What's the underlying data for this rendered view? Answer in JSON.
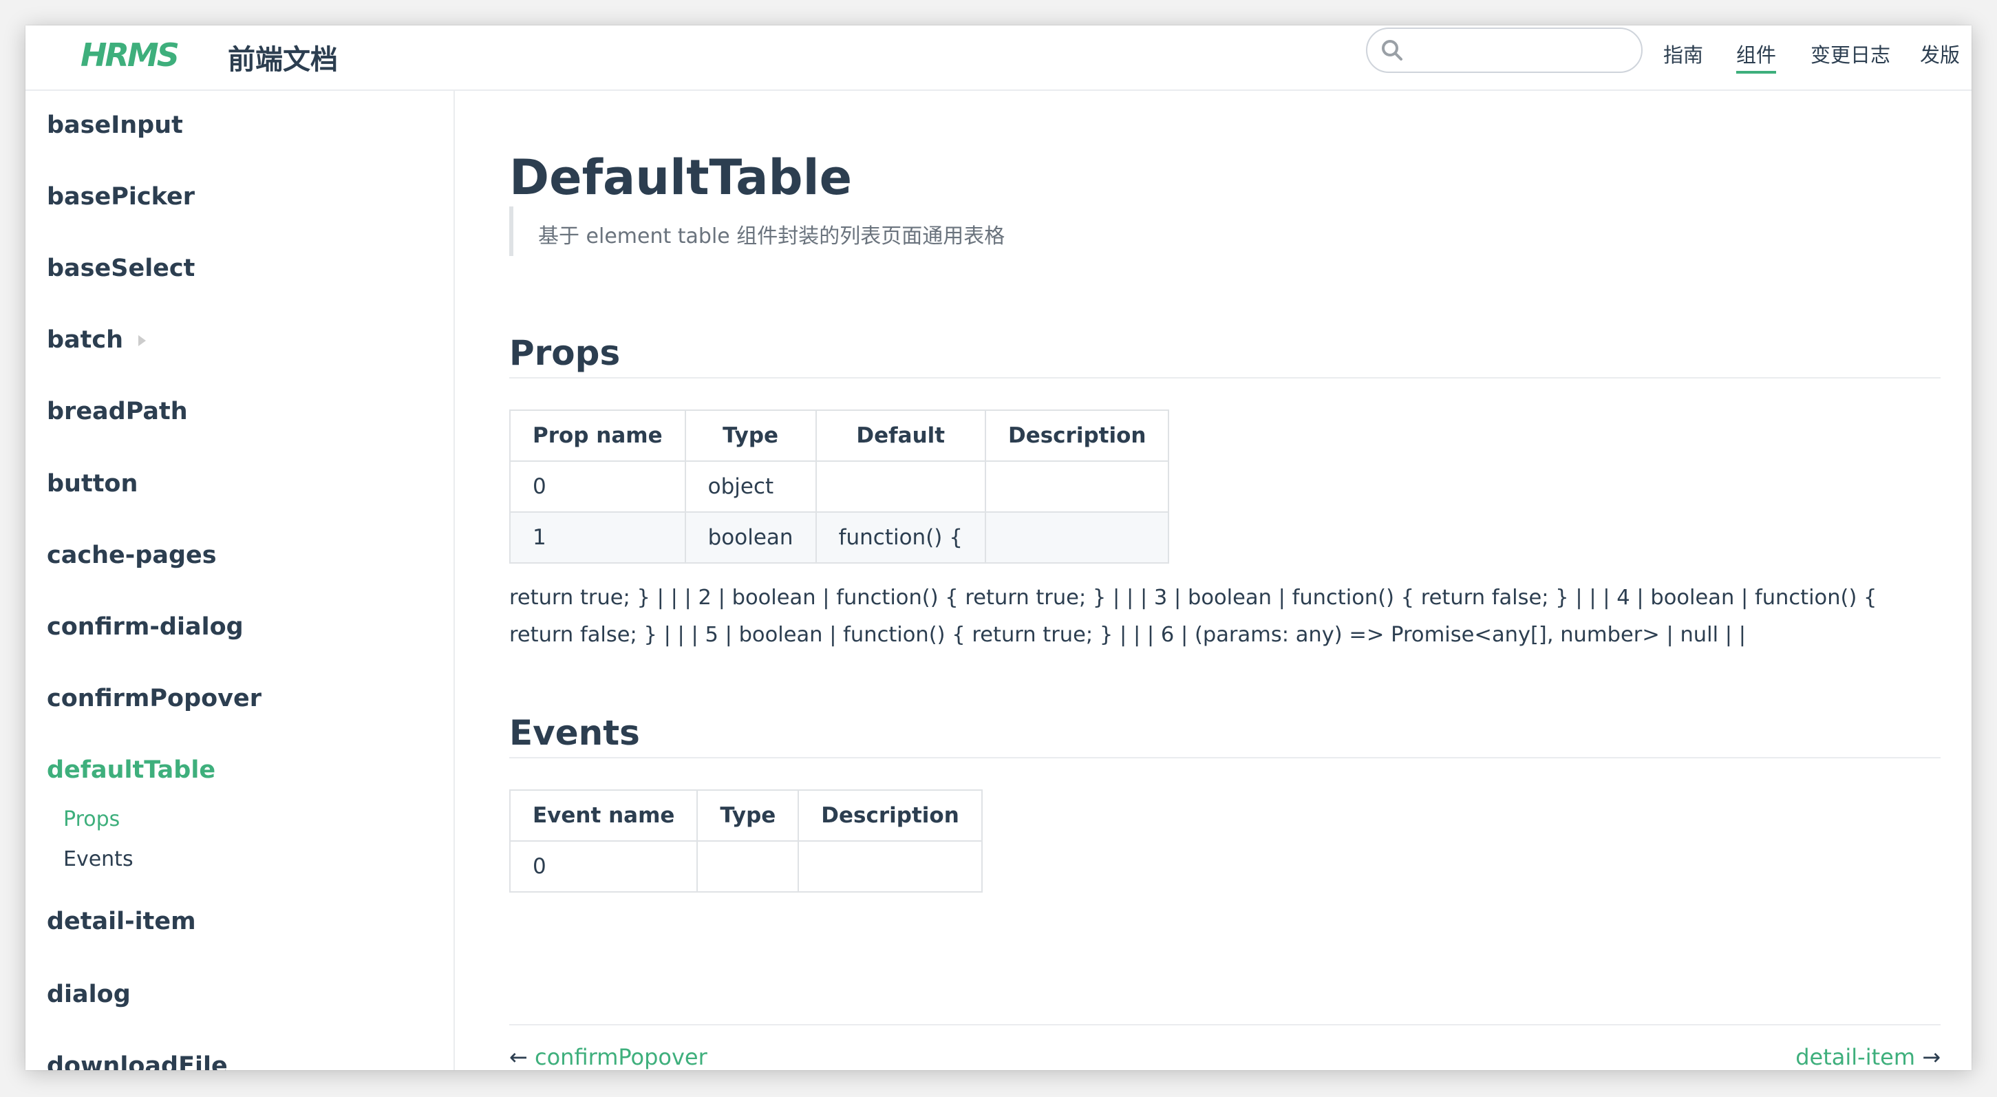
{
  "header": {
    "logo": "HRMS",
    "site_title": "前端文档",
    "search_placeholder": "",
    "nav": [
      "指南",
      "组件",
      "变更日志",
      "发版"
    ],
    "active_nav": "组件"
  },
  "sidebar": {
    "items": [
      {
        "label": "baseInput"
      },
      {
        "label": "basePicker"
      },
      {
        "label": "baseSelect"
      },
      {
        "label": "batch",
        "has_arrow": true
      },
      {
        "label": "breadPath"
      },
      {
        "label": "button"
      },
      {
        "label": "cache-pages"
      },
      {
        "label": "confirm-dialog"
      },
      {
        "label": "confirmPopover"
      },
      {
        "label": "defaultTable",
        "active": true
      },
      {
        "label": "detail-item"
      },
      {
        "label": "dialog"
      },
      {
        "label": "downloadFile"
      }
    ],
    "subitems": [
      {
        "label": "Props",
        "active": true
      },
      {
        "label": "Events"
      }
    ]
  },
  "content": {
    "title": "DefaultTable",
    "description": "基于 element table 组件封装的列表页面通用表格",
    "props_heading": "Props",
    "props_table": {
      "headers": [
        "Prop name",
        "Type",
        "Default",
        "Description"
      ],
      "rows": [
        [
          "0",
          "object",
          "",
          ""
        ],
        [
          "1",
          "boolean",
          "function() {",
          ""
        ]
      ]
    },
    "paragraph": "return true; } | | | 2 | boolean | function() { return true; } | | | 3 | boolean | function() { return false; } | | | 4 | boolean | function() { return false; } | | | 5 | boolean | function() { return true; } | | | 6 | (params: any) => Promise<any[], number> | null | |",
    "events_heading": "Events",
    "events_table": {
      "headers": [
        "Event name",
        "Type",
        "Description"
      ],
      "rows": [
        [
          "0",
          "",
          ""
        ]
      ]
    },
    "prev": {
      "arrow": "←",
      "label": "confirmPopover"
    },
    "next": {
      "arrow": "→",
      "label": "detail-item"
    }
  },
  "colors": {
    "accent": "#3eaf7c",
    "text": "#2c3e50",
    "muted": "#6a737d",
    "border": "#dfe2e5"
  }
}
